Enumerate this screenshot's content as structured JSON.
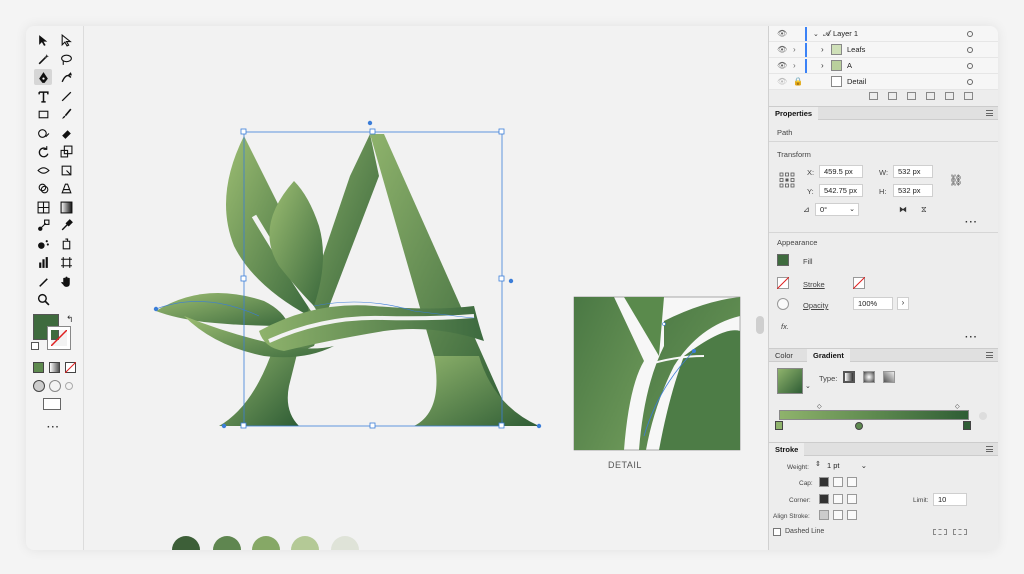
{
  "layers": [
    {
      "name": "Layer 1",
      "visible": true,
      "locked": false
    },
    {
      "name": "Leafs",
      "visible": true,
      "locked": false
    },
    {
      "name": "A",
      "visible": true,
      "locked": false
    },
    {
      "name": "Detail",
      "visible": false,
      "locked": true
    }
  ],
  "properties": {
    "tab_label": "Properties",
    "kind": "Path",
    "transform_label": "Transform",
    "x_label": "X:",
    "x_value": "459.5 px",
    "y_label": "Y:",
    "y_value": "542.75 px",
    "w_label": "W:",
    "w_value": "532 px",
    "h_label": "H:",
    "h_value": "532 px",
    "angle_value": "0°",
    "appearance_label": "Appearance",
    "fill_label": "Fill",
    "stroke_label": "Stroke",
    "opacity_label": "Opacity",
    "opacity_value": "100%",
    "fx_label": "fx."
  },
  "gradient_panel": {
    "tabs": [
      "Color",
      "Gradient"
    ],
    "active_tab": "Gradient",
    "type_label": "Type:"
  },
  "stroke_panel": {
    "title": "Stroke",
    "weight_label": "Weight:",
    "weight_value": "1 pt",
    "cap_label": "Cap:",
    "corner_label": "Corner:",
    "limit_label": "Limit:",
    "limit_value": "10",
    "align_label": "Align Stroke:",
    "dashed_label": "Dashed Line"
  },
  "canvas": {
    "detail_label": "DETAIL"
  },
  "colors": {
    "dark_green": "#3f6b3e",
    "mid_green": "#5e8a4f",
    "light_green": "#8fb36c",
    "pale_green": "#c8d8b0",
    "selection_blue": "#3b7dd8",
    "swatches": [
      "#3d5f38",
      "#5f8650",
      "#86a866",
      "#b4c996",
      "#dfe3d8"
    ]
  }
}
